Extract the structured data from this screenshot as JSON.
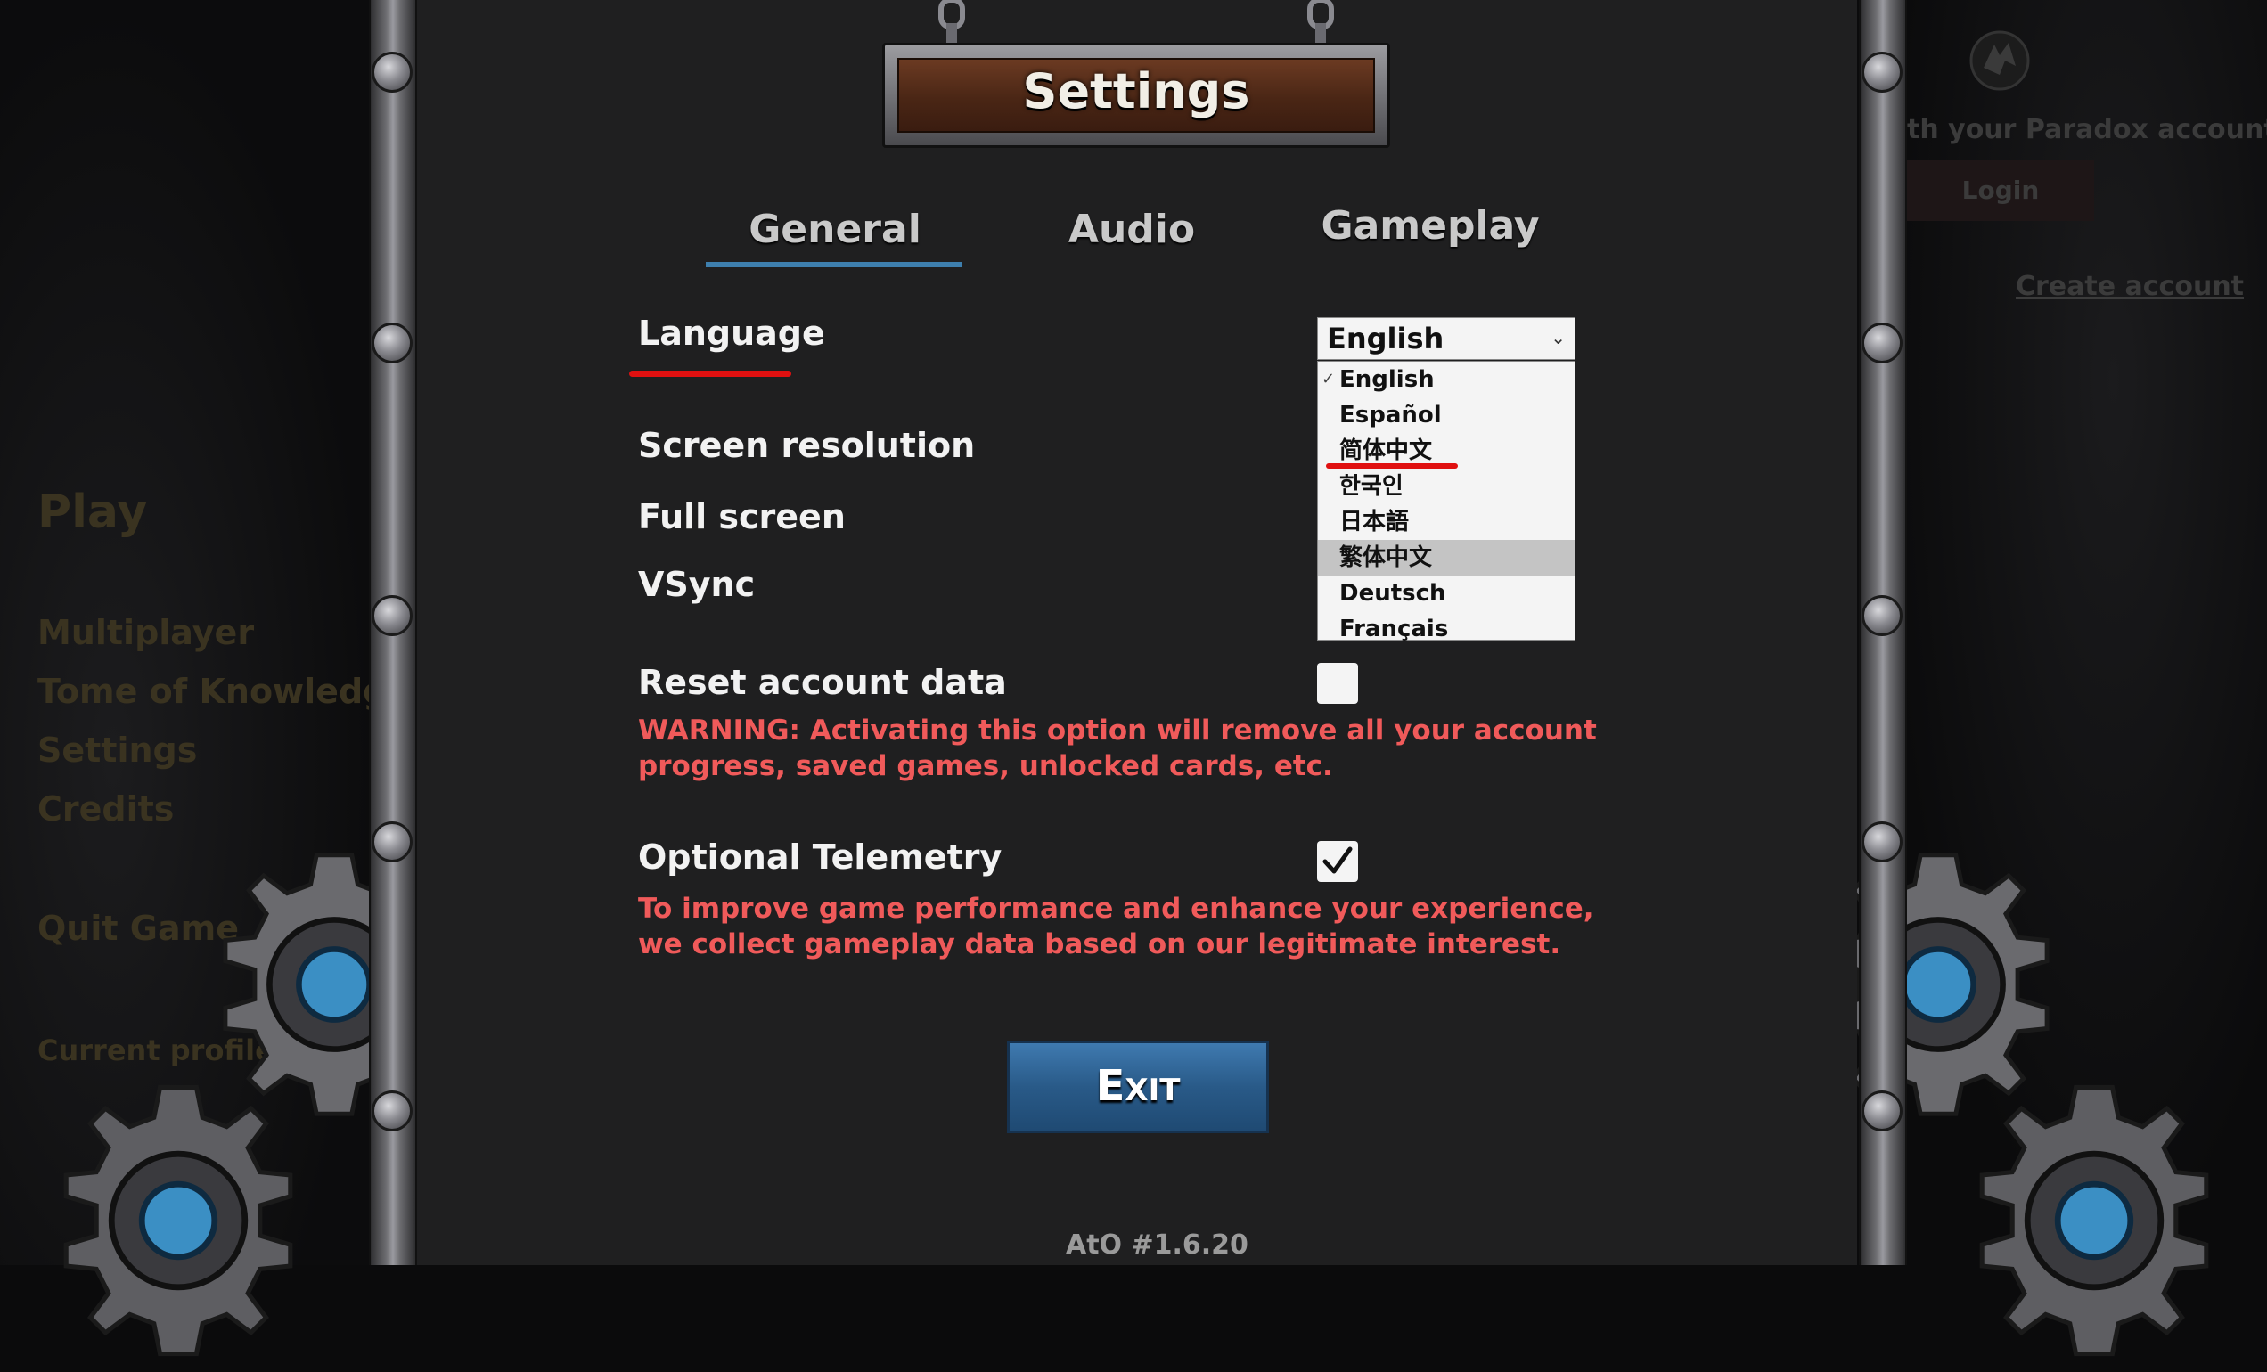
{
  "background_menu": {
    "play": "Play",
    "items": [
      "Multiplayer",
      "Tome of Knowledge",
      "Settings",
      "Credits"
    ],
    "quit": "Quit Game",
    "current_profile": "Current profile",
    "paradox_text": "th your Paradox account",
    "login_label": "Login",
    "create_account": "Create account"
  },
  "dialog": {
    "title": "Settings",
    "tabs": [
      {
        "label": "General",
        "active": true
      },
      {
        "label": "Audio",
        "active": false
      },
      {
        "label": "Gameplay",
        "active": false
      }
    ],
    "language": {
      "label": "Language",
      "selected": "English",
      "options": [
        "English",
        "Español",
        "简体中文",
        "한국인",
        "日本語",
        "繁体中文",
        "Deutsch",
        "Français"
      ],
      "hovered_option": "繁体中文"
    },
    "screen_resolution": {
      "label": "Screen resolution"
    },
    "full_screen": {
      "label": "Full screen"
    },
    "vsync": {
      "label": "VSync"
    },
    "reset_account": {
      "label": "Reset account data",
      "checked": false,
      "warning": "WARNING: Activating this option will remove all your account progress, saved games, unlocked cards, etc."
    },
    "telemetry": {
      "label": "Optional Telemetry",
      "checked": true,
      "note": "To improve game performance and enhance your experience, we collect gameplay data based on our legitimate interest."
    },
    "exit_label": "Exit",
    "version": "AtO #1.6.20"
  },
  "colors": {
    "panel": "#1f1f20",
    "accent_blue": "#3e7fae",
    "warning_red": "#f05a5a",
    "annotation_red": "#e01010"
  }
}
